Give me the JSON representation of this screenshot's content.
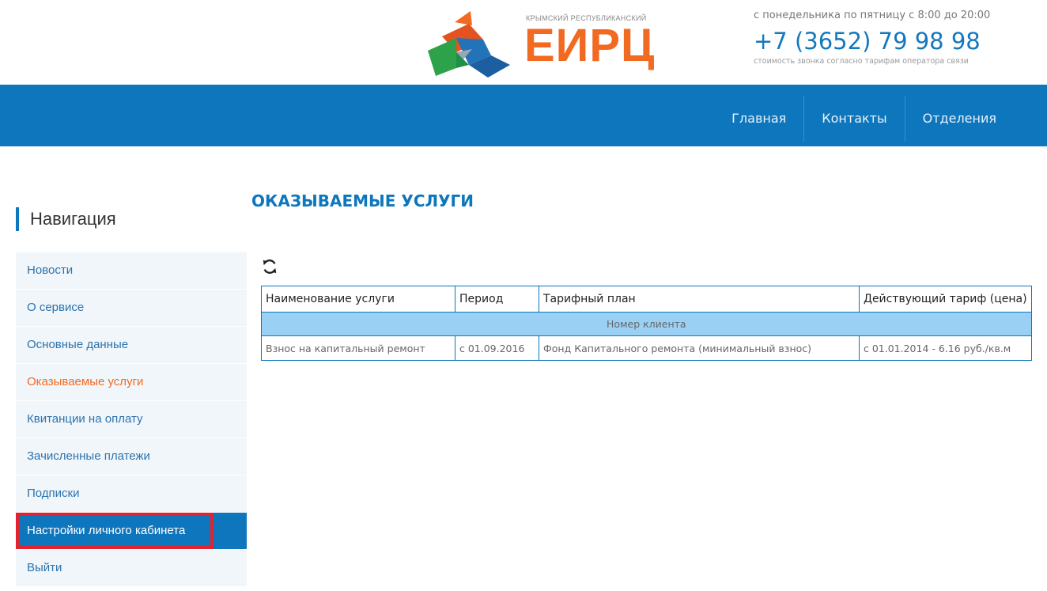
{
  "header": {
    "logo_subtitle": "КРЫМСКИЙ РЕСПУБЛИКАНСКИЙ",
    "logo_name": "ЕИРЦ",
    "hours": "с понедельника по пятницу с 8:00 до 20:00",
    "phone": "+7 (3652) 79 98 98",
    "call_note": "стоимость звонка согласно тарифам оператора связи"
  },
  "topnav": {
    "items": [
      {
        "label": "Главная"
      },
      {
        "label": "Контакты"
      },
      {
        "label": "Отделения"
      }
    ]
  },
  "sidebar": {
    "heading": "Навигация",
    "items": [
      {
        "label": "Новости"
      },
      {
        "label": "О сервисе"
      },
      {
        "label": "Основные данные"
      },
      {
        "label": "Оказываемые услуги"
      },
      {
        "label": "Квитанции на оплату"
      },
      {
        "label": "Зачисленные платежи"
      },
      {
        "label": "Подписки"
      },
      {
        "label": "Настройки личного кабинета"
      },
      {
        "label": "Выйти"
      }
    ]
  },
  "main": {
    "title": "ОКАЗЫВАЕМЫЕ УСЛУГИ",
    "refresh_icon": "refresh-icon",
    "table": {
      "headers": [
        "Наименование услуги",
        "Период",
        "Тарифный план",
        "Действующий тариф (цена)"
      ],
      "group_label": "Номер клиента",
      "rows": [
        [
          "Взнос на капитальный ремонт",
          "с 01.09.2016",
          "Фонд Капитального ремонта (минимальный взнос)",
          "с 01.01.2014 - 6.16 руб./кв.м"
        ]
      ]
    }
  },
  "colors": {
    "brand_blue": "#0e76bc",
    "brand_orange": "#f26a21",
    "group_row": "#9bd0f5",
    "highlight_border": "#e2232f"
  }
}
